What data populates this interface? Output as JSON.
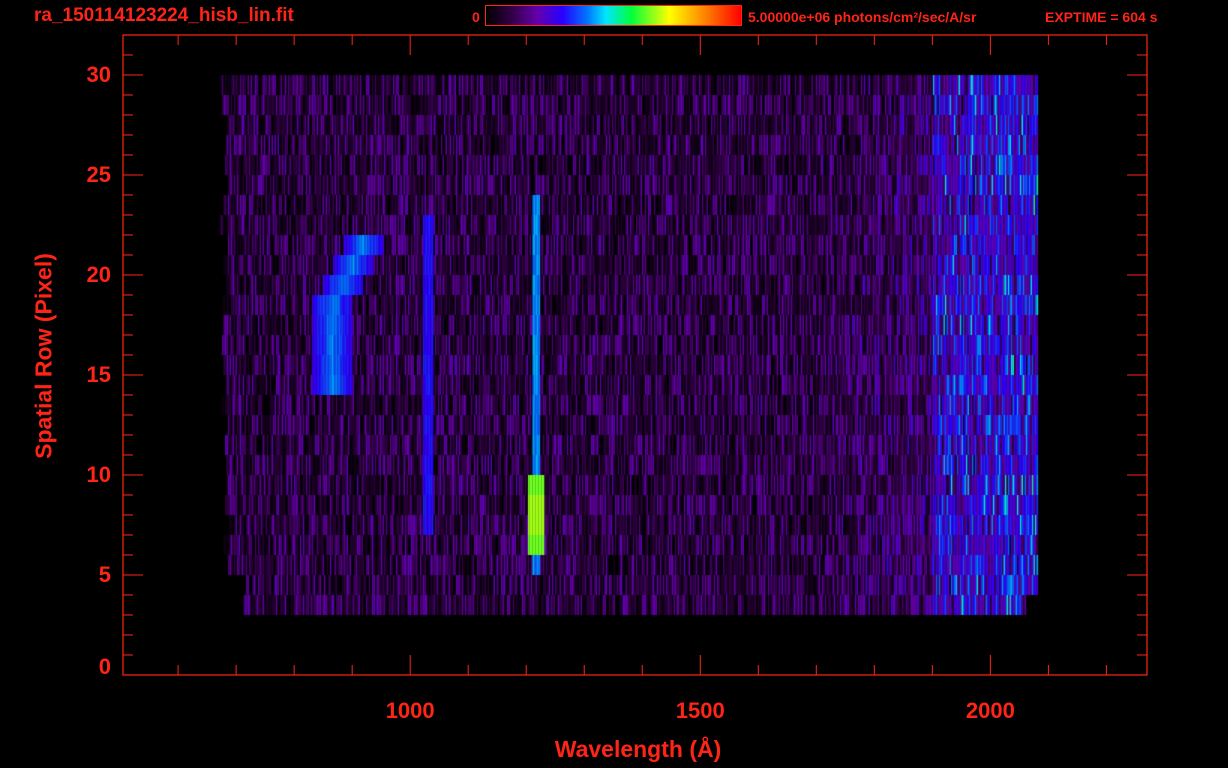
{
  "header": {
    "title": "ra_150114123224_hisb_lin.fit",
    "colorbar_min_label": "0",
    "colorbar_max_label": "5.00000e+06 photons/cm²/sec/A/sr",
    "exptime": "EXPTIME = 604 s"
  },
  "colors": {
    "axis": "#ff2418",
    "background": "#000000"
  },
  "chart_data": {
    "type": "heatmap",
    "title": "ra_150114123224_hisb_lin.fit",
    "xlabel": "Wavelength (Å)",
    "ylabel": "Spatial Row (Pixel)",
    "xlim": [
      505,
      2270
    ],
    "ylim": [
      0,
      32
    ],
    "x_ticks": [
      1000,
      1500,
      2000
    ],
    "x_tick_labels": [
      "1000",
      "1500",
      "2000"
    ],
    "x_minor_step": 100,
    "y_ticks": [
      0,
      5,
      10,
      15,
      20,
      25,
      30
    ],
    "y_tick_labels": [
      "0",
      "5",
      "10",
      "15",
      "20",
      "25",
      "30"
    ],
    "y_minor_step": 1,
    "colorbar": {
      "min": 0,
      "max": 5000000,
      "units": "photons/cm^2/sec/A/sr",
      "colormap": "rainbow"
    },
    "data_extent": {
      "wavelength": [
        672,
        2080
      ],
      "rows": [
        3,
        30
      ]
    },
    "features": [
      {
        "name": "Lyman-alpha emission",
        "wavelength": 1216,
        "rows": [
          5,
          24
        ],
        "peak_rows": [
          6,
          10
        ],
        "peak_fraction": 0.68
      },
      {
        "name": "emission line",
        "wavelength": 1030,
        "rows": [
          7,
          23
        ],
        "peak_fraction": 0.28
      },
      {
        "name": "curved emission feature",
        "wavelength": [
          850,
          930
        ],
        "rows": [
          14,
          22
        ],
        "peak_fraction": 0.44
      },
      {
        "name": "long-wavelength noise increase",
        "wavelength": [
          1850,
          2080
        ],
        "peak_fraction": 0.6
      }
    ]
  }
}
